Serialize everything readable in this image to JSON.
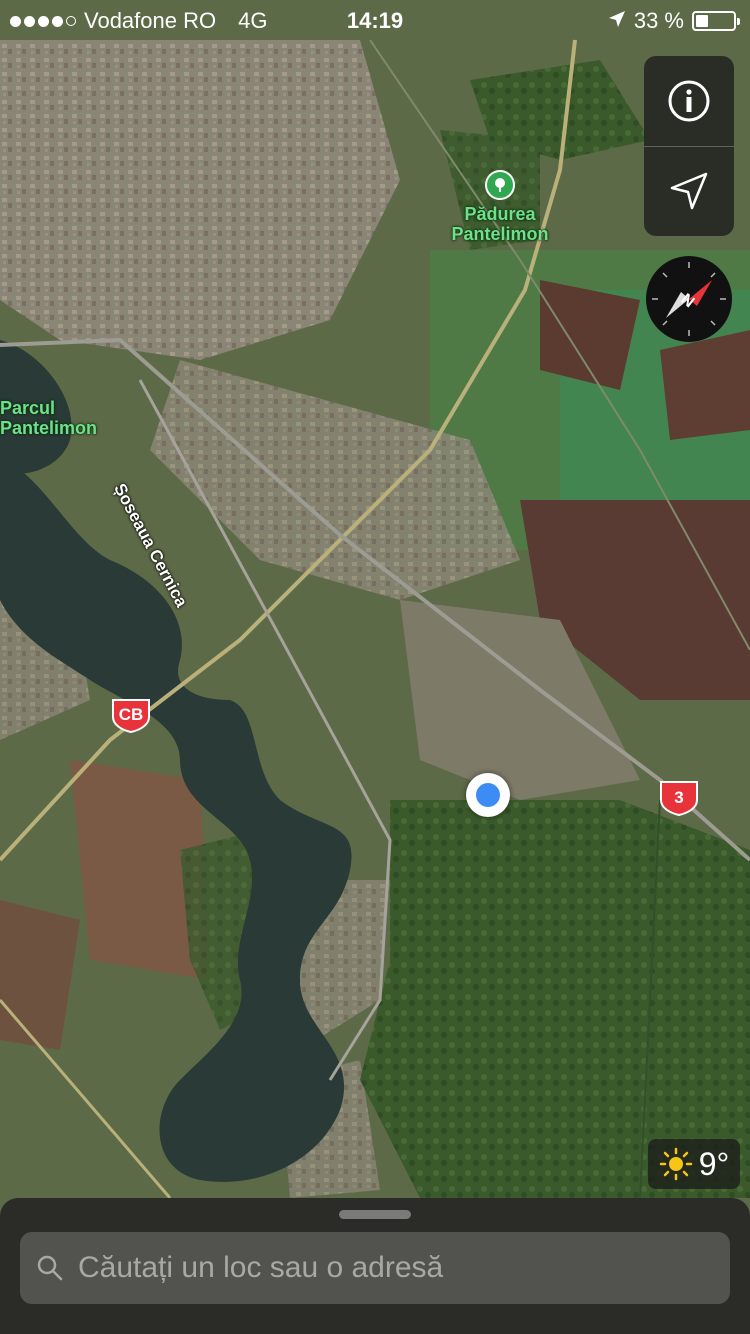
{
  "status_bar": {
    "carrier": "Vodafone RO",
    "network": "4G",
    "time": "14:19",
    "battery_percent": "33 %",
    "battery_level": 0.33,
    "signal_bars": 4,
    "signal_max": 5
  },
  "map": {
    "pois": [
      {
        "line1": "Pădurea",
        "line2": "Pantelimon",
        "icon": "tree-icon"
      },
      {
        "line1": "Parcul",
        "line2": "Pantelimon"
      }
    ],
    "road_label": "Șoseaua Cernica",
    "shields": [
      "CB",
      "3"
    ]
  },
  "controls": {
    "info_icon": "info-icon",
    "location_icon": "location-arrow-icon",
    "compass_letter": "N"
  },
  "weather": {
    "icon": "sun-icon",
    "temperature": "9°"
  },
  "search": {
    "placeholder": "Căutați un loc sau o adresă"
  },
  "colors": {
    "accent_blue": "#3d8cf5",
    "poi_green": "#6fe08a",
    "shield_red": "#e8333a"
  }
}
